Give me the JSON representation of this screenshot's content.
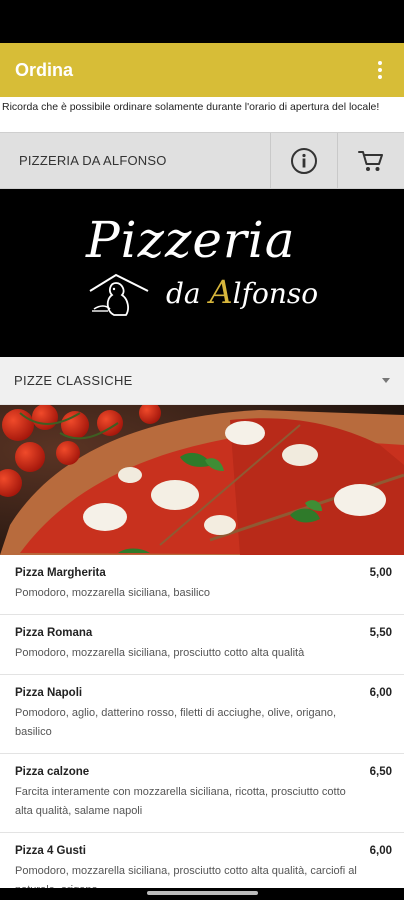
{
  "app_bar": {
    "title": "Ordina",
    "menu_icon": "overflow-menu-icon"
  },
  "notice": "Ricorda che è possibile ordinare solamente durante l'orario di apertura del locale!",
  "restaurant": {
    "name": "PIZZERIA DA ALFONSO",
    "info_icon": "info-icon",
    "cart_icon": "cart-icon"
  },
  "logo": {
    "line1": "Pizzeria",
    "line2_prefix": "da ",
    "line2_initial": "A",
    "line2_rest": "lfonso"
  },
  "category": {
    "label": "PIZZE CLASSICHE",
    "expand_icon": "chevron-down-icon"
  },
  "menu": [
    {
      "name": "Pizza Margherita",
      "price": "5,00",
      "description": "Pomodoro, mozzarella siciliana, basilico"
    },
    {
      "name": "Pizza Romana",
      "price": "5,50",
      "description": "Pomodoro, mozzarella siciliana, prosciutto cotto alta qualità"
    },
    {
      "name": "Pizza Napoli",
      "price": "6,00",
      "description": "Pomodoro, aglio, datterino rosso, filetti di acciughe, olive, origano, basilico"
    },
    {
      "name": "Pizza calzone",
      "price": "6,50",
      "description": "Farcita interamente con mozzarella siciliana, ricotta, prosciutto cotto alta qualità, salame napoli"
    },
    {
      "name": "Pizza 4 Gusti",
      "price": "6,00",
      "description": "Pomodoro, mozzarella siciliana, prosciutto cotto alta qualità, carciofi al naturale, origano"
    }
  ],
  "colors": {
    "accent": "#d7bd37",
    "logo_gold": "#d7b63c"
  }
}
